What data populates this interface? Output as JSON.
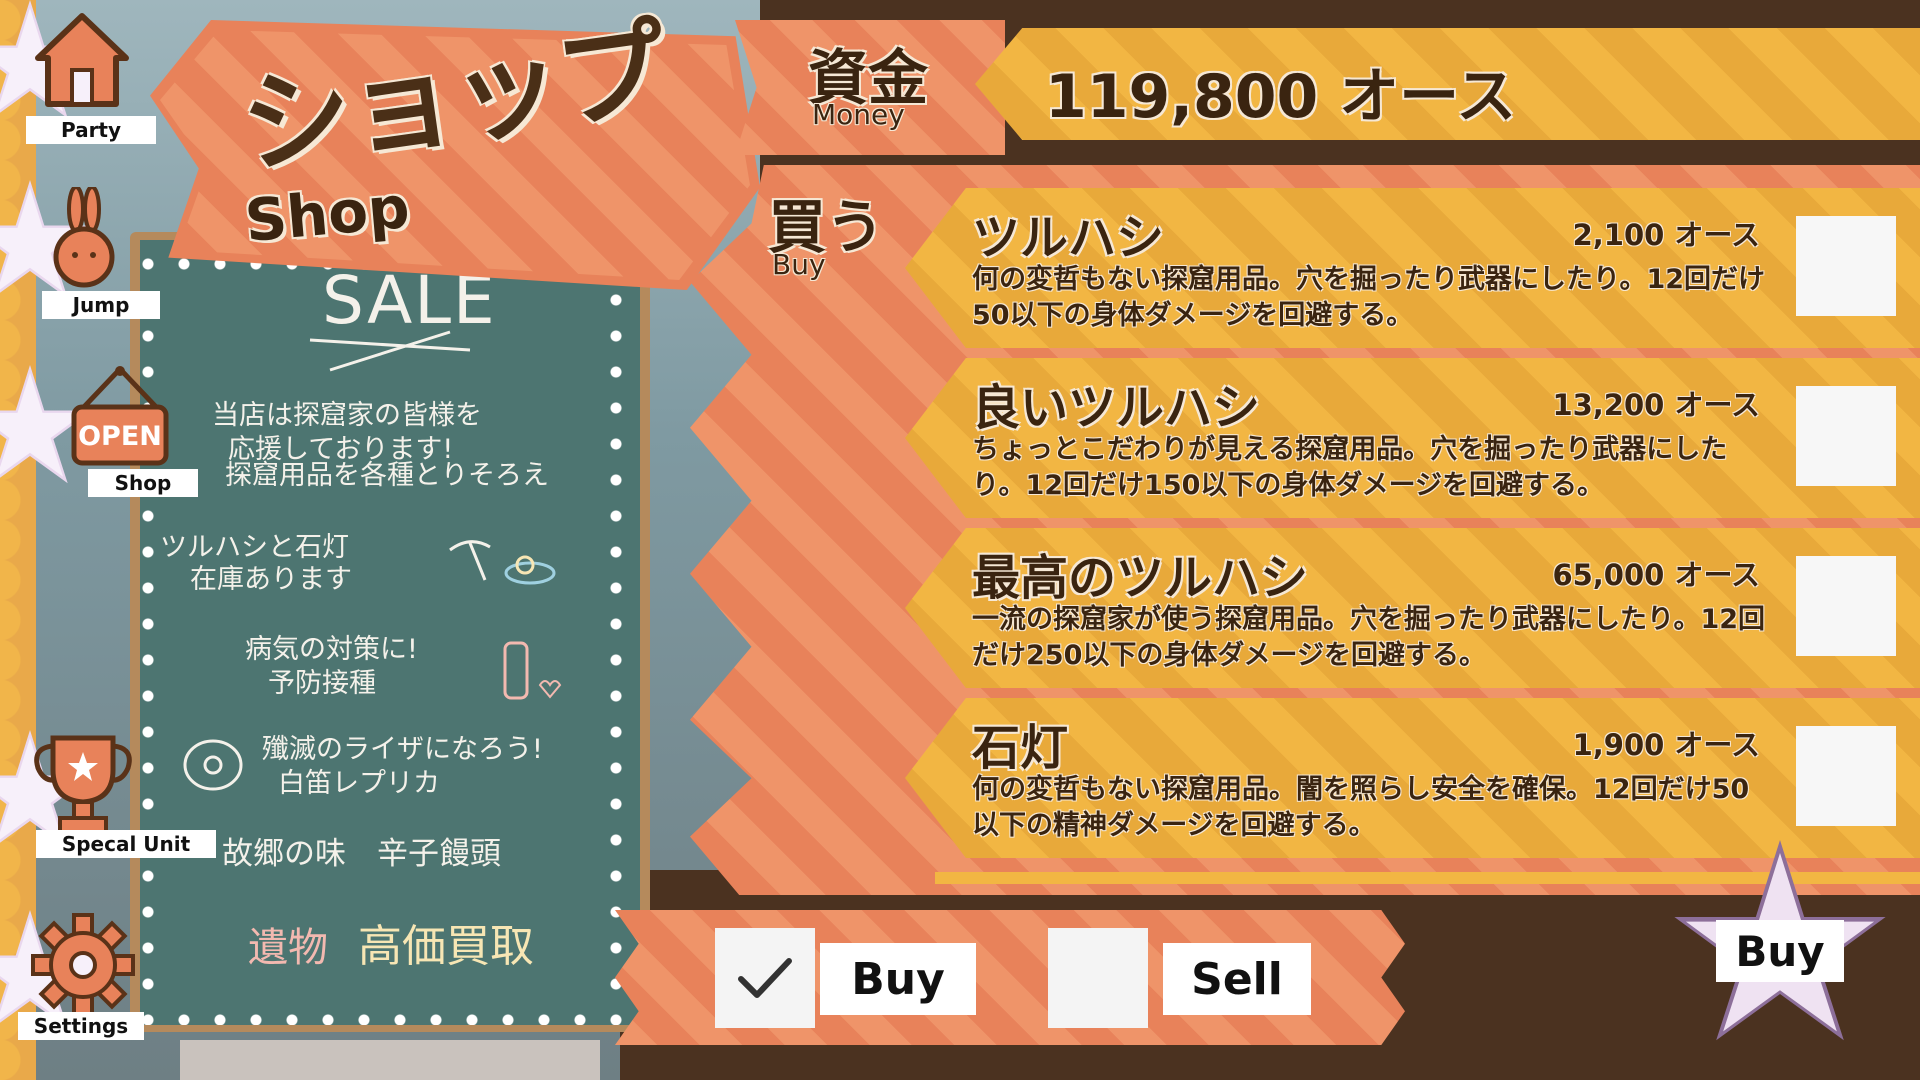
{
  "side_menu": [
    {
      "label": "Party",
      "icon": "home-icon"
    },
    {
      "label": "Jump",
      "icon": "rabbit-icon"
    },
    {
      "label": "Shop",
      "icon": "open-sign-icon",
      "sign_text": "OPEN"
    },
    {
      "label": "Specal Unit",
      "icon": "trophy-icon"
    },
    {
      "label": "Settings",
      "icon": "gear-icon"
    }
  ],
  "title": {
    "jp": "ショップ",
    "en": "Shop"
  },
  "chalkboard": {
    "heading": "SALE",
    "intro": [
      "当店は探窟家の皆様を",
      "応援しております!",
      "探窟用品を各種とりそろえ"
    ],
    "notice1": [
      "ツルハシと石灯",
      "在庫あります"
    ],
    "notice2": [
      "病気の対策に!",
      "予防接種"
    ],
    "notice3": [
      "殲滅のライザになろう!",
      "白笛レプリカ"
    ],
    "notice4": "故郷の味　辛子饅頭",
    "notice5_a": "遺物",
    "notice5_b": "高価買取"
  },
  "money": {
    "label_jp": "資金",
    "label_en": "Money",
    "value": "119,800 オース"
  },
  "buy_section": {
    "label_jp": "買う",
    "label_en": "Buy"
  },
  "items": [
    {
      "name": "ツルハシ",
      "price": "2,100 オース",
      "description": "何の変哲もない探窟用品。穴を掘ったり武器にしたり。12回だけ50以下の身体ダメージを回避する。"
    },
    {
      "name": "良いツルハシ",
      "price": "13,200 オース",
      "description": "ちょっとこだわりが見える探窟用品。穴を掘ったり武器にしたり。12回だけ150以下の身体ダメージを回避する。"
    },
    {
      "name": "最高のツルハシ",
      "price": "65,000 オース",
      "description": "一流の探窟家が使う探窟用品。穴を掘ったり武器にしたり。12回だけ250以下の身体ダメージを回避する。"
    },
    {
      "name": "石灯",
      "price": "1,900 オース",
      "description": "何の変哲もない探窟用品。闇を照らし安全を確保。12回だけ50以下の精神ダメージを回避する。"
    }
  ],
  "mode_toggle": {
    "buy_label": "Buy",
    "sell_label": "Sell",
    "selected": "Buy"
  },
  "action_button": {
    "label": "Buy"
  },
  "colors": {
    "accent_orange": "#e8825a",
    "gold": "#f2b643",
    "text_brown": "#3a2410",
    "lavender": "#e9d7ee"
  }
}
